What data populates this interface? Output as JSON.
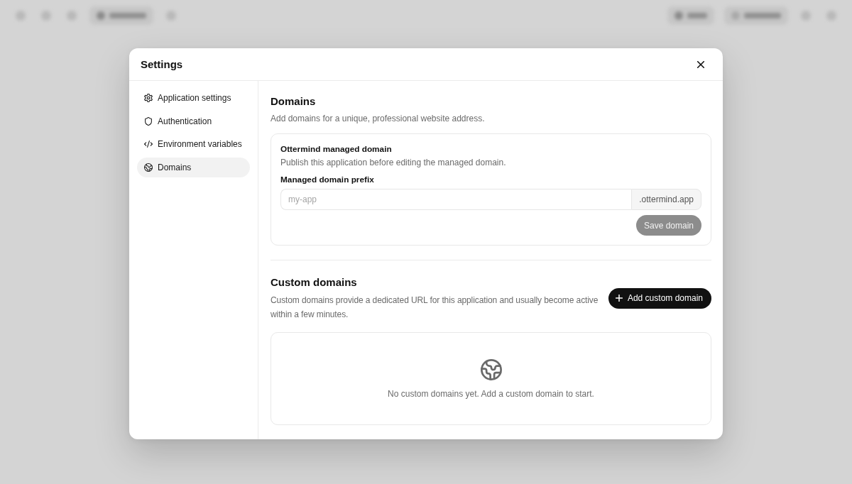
{
  "dialog": {
    "title": "Settings",
    "sidebar": {
      "items": [
        {
          "label": "Application settings",
          "selected": false
        },
        {
          "label": "Authentication",
          "selected": false
        },
        {
          "label": "Environment variables",
          "selected": false
        },
        {
          "label": "Domains",
          "selected": true
        }
      ]
    },
    "domains": {
      "title": "Domains",
      "description": "Add domains for a unique, professional website address.",
      "managed_domain": {
        "title": "Ottermind managed domain",
        "description": "Publish this application before editing the managed domain.",
        "field_label": "Managed domain prefix",
        "placeholder": "my-app",
        "suffix": ".ottermind.app",
        "save_button": {
          "label": "Save domain",
          "disabled": true
        }
      }
    },
    "custom_domains": {
      "title": "Custom domains",
      "description": "Custom domains provide a dedicated URL for this application and usually become active within a few minutes.",
      "add_button": {
        "label": "Add custom domain"
      },
      "empty_state": {
        "message": "No custom domains yet. Add a custom domain to start."
      }
    }
  }
}
